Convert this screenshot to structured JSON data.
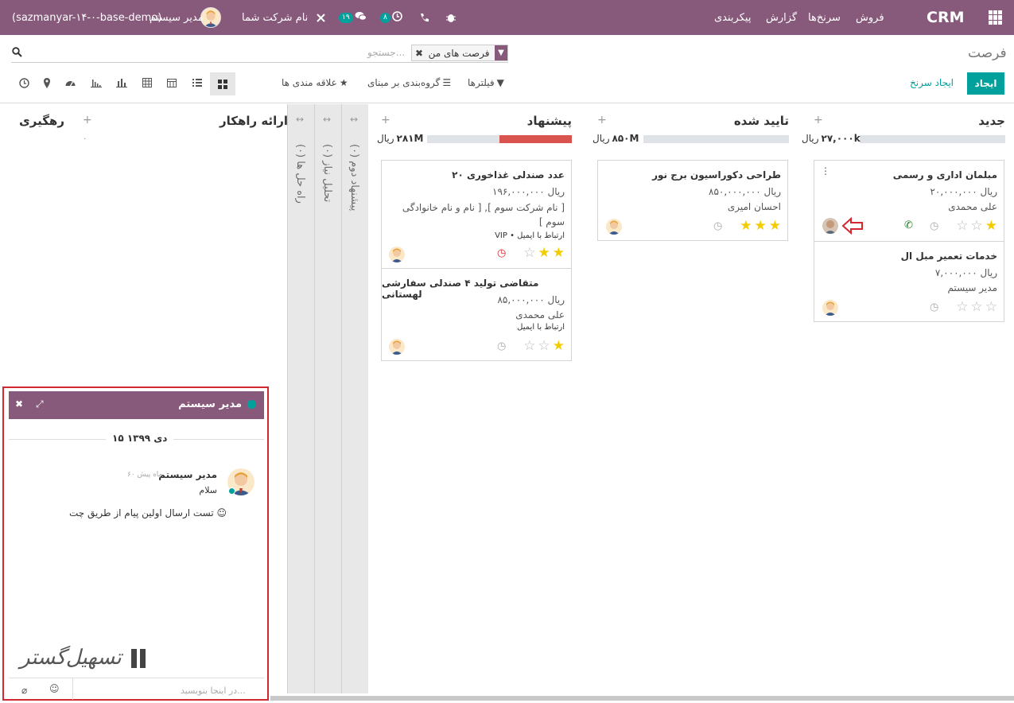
{
  "navbar": {
    "app_name": "CRM",
    "menu": [
      "فروش",
      "سرنخ‌ها",
      "گزارش",
      "پیکربندی"
    ],
    "db_name": "(sazmanyar-۱۴-۰-base-demo)",
    "user_name": "مدیر سیستم",
    "company": "نام شرکت شما",
    "messages_count": "۱۹",
    "activities_count": "۸",
    "icons": [
      "apps-icon",
      "bug-icon",
      "phone-icon",
      "clock-icon",
      "chat-icon",
      "company-switch-icon"
    ]
  },
  "control_panel": {
    "breadcrumb": "فرصت",
    "facet": "فرصت های من",
    "search_placeholder": "جستجو...",
    "create_label": "ایجاد",
    "create_lead_label": "ایجاد سرنخ",
    "filters_label": "فیلترها",
    "groupby_label": "گروه‌بندی بر مبنای",
    "favorites_label": "علاقه مندی ها",
    "views": [
      "kanban",
      "list",
      "calendar",
      "pivot",
      "graph",
      "cohort",
      "dashboard",
      "map",
      "activity"
    ]
  },
  "kanban": {
    "columns": [
      {
        "title": "جدید",
        "total": "۲۷,۰۰۰k",
        "currency": "ریال",
        "progress": {
          "green": 0,
          "red": 0,
          "grey": 1
        },
        "cards": [
          {
            "name": "مبلمان اداری و رسمی",
            "amount": "۲۰,۰۰۰,۰۰۰ ریال",
            "contact": "علی محمدی",
            "stars": 1,
            "tags": ""
          },
          {
            "name": "خدمات تعمیر مبل ال",
            "amount": "۷,۰۰۰,۰۰۰ ریال",
            "contact": "مدیر سیستم",
            "stars": 0,
            "tags": ""
          }
        ]
      },
      {
        "title": "تایید شده",
        "total": "۸۵۰M",
        "currency": "ریال",
        "progress": {
          "green": 0,
          "red": 0,
          "grey": 1
        },
        "cards": [
          {
            "name": "طراحی دکوراسیون برج نور",
            "amount": "۸۵۰,۰۰۰,۰۰۰ ریال",
            "contact": "احسان امیری",
            "stars": 3,
            "tags": ""
          }
        ]
      },
      {
        "title": "پیشنهاد",
        "total": "۲۸۱M",
        "currency": "ریال",
        "progress": {
          "green": 0,
          "red": 0.5,
          "grey": 0.5
        },
        "cards": [
          {
            "name": "۲۰ عدد صندلی غذاخوری",
            "amount": "۱۹۶,۰۰۰,۰۰۰ ریال",
            "contact": "[ نام شرکت سوم ], [ نام و نام خانوادگی سوم ]",
            "stars": 2,
            "tags": "VIP • ارتباط با ایمیل"
          },
          {
            "name": "متقاضی تولید ۴ صندلی سفارشی لهستانی",
            "amount": "۸۵,۰۰۰,۰۰۰ ریال",
            "contact": "علی محمدی",
            "stars": 1,
            "tags": "ارتباط با ایمیل"
          }
        ]
      }
    ],
    "folded": [
      "پیشنهاد دوم (۰)",
      "تحلیل نیاز (۰)",
      "راه حل ها (۰)"
    ],
    "more_columns": [
      {
        "title": "ارائه راهکار",
        "count": "۰"
      },
      {
        "title": "رهگیری"
      }
    ]
  },
  "chat": {
    "title": "مدیر سیستم",
    "date_separator": "۱۵ دی ۱۳۹۹",
    "author": "مدیر سیستم",
    "time_ago": "۶۰ ماه پیش",
    "message1": "سلام",
    "message2": "تست ارسال اولین پیام از طریق چت ☺",
    "composer_placeholder": "در اینجا بنویسید...",
    "watermark": "تسهیل‌گستر"
  },
  "colors": {
    "brand": "#875a7b",
    "accent": "#00a09d",
    "star": "#f3cc00",
    "red_box": "#d3282f"
  }
}
